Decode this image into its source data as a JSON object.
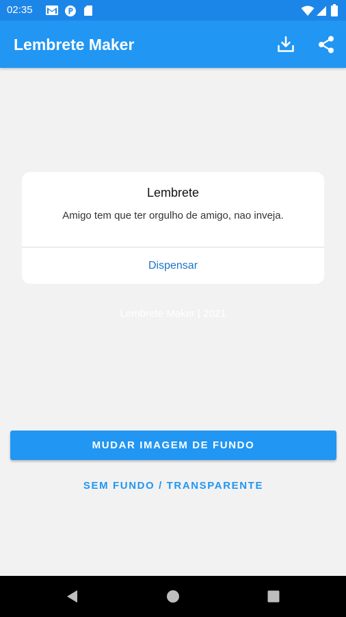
{
  "status_bar": {
    "time": "02:35",
    "icons": [
      "gmail-icon",
      "notification-p-icon",
      "sd-card-icon",
      "wifi-icon",
      "signal-icon",
      "battery-icon"
    ]
  },
  "app_bar": {
    "title": "Lembrete Maker",
    "actions": [
      "download-icon",
      "share-icon"
    ],
    "color": "#2196f3"
  },
  "dialog": {
    "title": "Lembrete",
    "message": "Amigo tem que ter orgulho de amigo, nao inveja.",
    "action_label": "Dispensar"
  },
  "watermark": "Lembrete Maker | 2021",
  "buttons": {
    "change_background": "MUDAR IMAGEM DE FUNDO",
    "no_background": "SEM FUNDO / TRANSPARENTE"
  },
  "nav_bar": {
    "icons": [
      "back-icon",
      "home-icon",
      "recents-icon"
    ]
  },
  "colors": {
    "accent": "#2196f3",
    "status_bar": "#1c86e8",
    "background": "#f2f2f2",
    "link": "#1a73c8"
  }
}
